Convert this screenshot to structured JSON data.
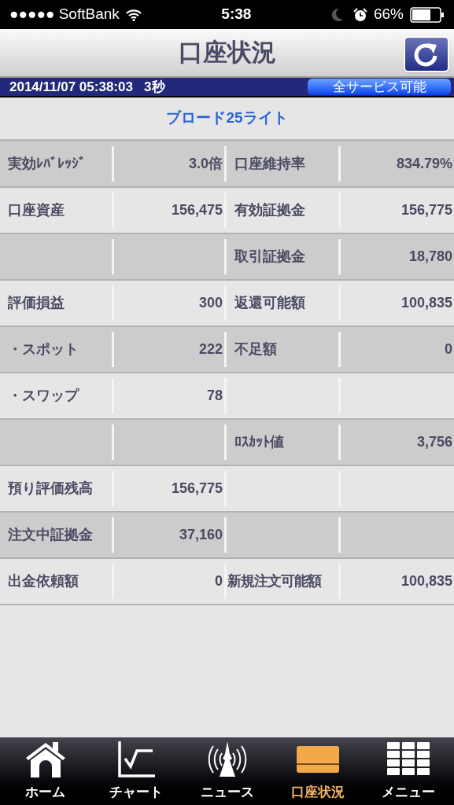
{
  "status_bar": {
    "carrier": "●●●●● SoftBank",
    "time": "5:38",
    "battery": "66%"
  },
  "nav": {
    "title": "口座状況"
  },
  "info_bar": {
    "timestamp": "2014/11/07 05:38:03",
    "interval": "3秒",
    "service_status": "全サービス可能"
  },
  "course": "ブロード25ライト",
  "rows": [
    {
      "label": "実効ﾚﾊﾞﾚｯｼﾞ",
      "value": "3.0倍",
      "label_2": "口座維持率",
      "value_2": "834.79%"
    },
    {
      "label": "口座資産",
      "value": "156,475",
      "label_2": "有効証拠金",
      "value_2": "156,775"
    },
    {
      "label_2": "取引証拠金",
      "value_2": "18,780"
    },
    {
      "label": "評価損益",
      "value": "300",
      "label_2": "返還可能額",
      "value_2": "100,835"
    },
    {
      "label": "・スポット",
      "value": "222",
      "label_2": "不足額",
      "value_2": "0"
    },
    {
      "label": "・スワップ",
      "value": "78"
    },
    {
      "label_2": "ﾛｽｶｯﾄ値",
      "value_2": "3,756"
    },
    {
      "label": "預り評価残高",
      "value": "156,775"
    },
    {
      "label": "注文中証拠金",
      "value": "37,160"
    },
    {
      "label": "出金依頼額",
      "value": "0",
      "label_2": "新規注文可能額",
      "value_2": "100,835"
    }
  ],
  "tabs": [
    {
      "kind": "home",
      "label": "ホーム",
      "selected": false
    },
    {
      "kind": "chart",
      "label": "チャート",
      "selected": false
    },
    {
      "kind": "news",
      "label": "ニュース",
      "selected": false
    },
    {
      "kind": "account",
      "label": "口座状況",
      "selected": true
    },
    {
      "kind": "menu",
      "label": "メニュー",
      "selected": false
    }
  ]
}
